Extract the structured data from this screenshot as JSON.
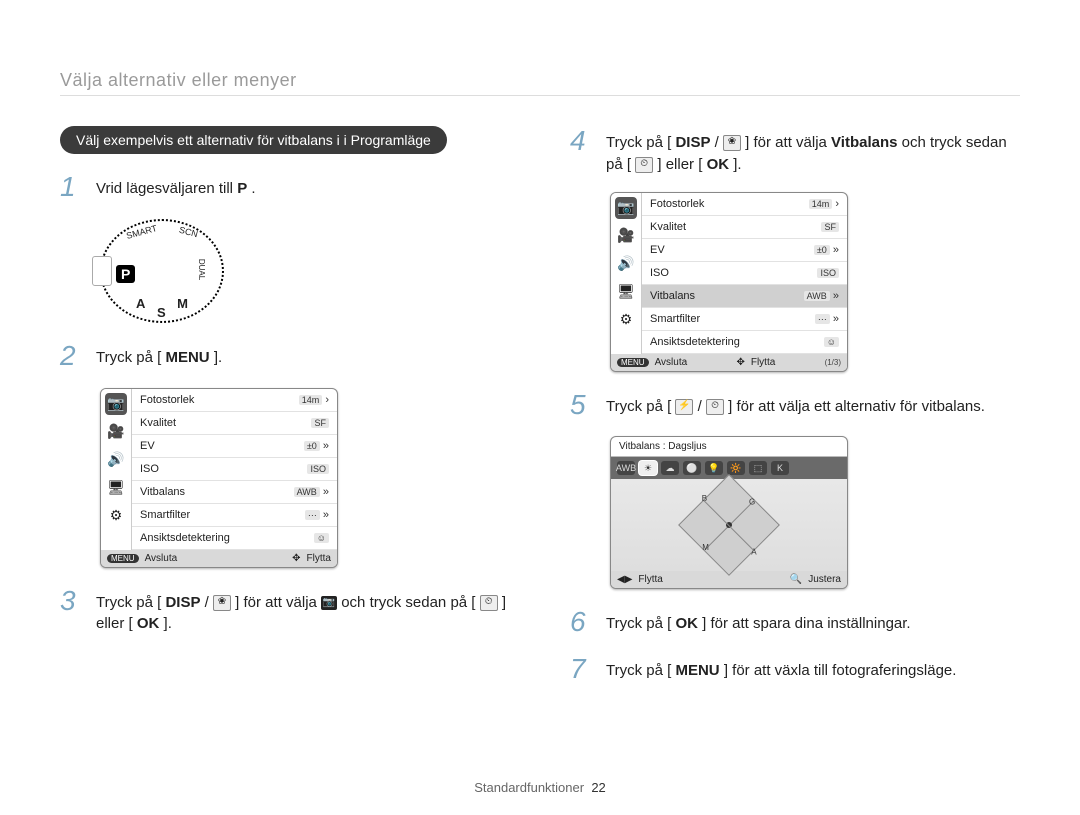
{
  "breadcrumb": "Välja alternativ eller menyer",
  "example_pill": "Välj exempelvis ett alternativ för vitbalans i i Programläge",
  "steps": {
    "1": {
      "num": "1",
      "text_a": "Vrid lägesväljaren till ",
      "mode_letter": "P",
      "text_b": "."
    },
    "2": {
      "num": "2",
      "text_a": "Tryck på [",
      "btn": "MENU",
      "text_b": "]."
    },
    "3": {
      "num": "3",
      "text_a": "Tryck på [",
      "btn_disp": "DISP",
      "text_b": "/",
      "icon_flower": "❀",
      "text_c": "] för att välja ",
      "icon_cam": "📷",
      "text_d": " och tryck sedan på [",
      "icon_timer": "⏲",
      "text_e": "] eller [",
      "btn_ok": "OK",
      "text_f": "]."
    },
    "4": {
      "num": "4",
      "text_a": "Tryck på [",
      "btn_disp": "DISP",
      "text_b": "/",
      "icon_flower": "❀",
      "text_c": "] för att välja ",
      "bold": "Vitbalans",
      "text_d": " och tryck sedan på [",
      "icon_timer": "⏲",
      "text_e": "] eller [",
      "btn_ok": "OK",
      "text_f": "]."
    },
    "5": {
      "num": "5",
      "text_a": "Tryck på [",
      "icon_flash": "⚡",
      "text_b": "/",
      "icon_timer": "⏲",
      "text_c": "] för att välja ett alternativ för vitbalans."
    },
    "6": {
      "num": "6",
      "text_a": "Tryck på [",
      "btn_ok": "OK",
      "text_b": "] för att spara dina inställningar."
    },
    "7": {
      "num": "7",
      "text_a": "Tryck på [",
      "btn_menu": "MENU",
      "text_b": "] för att växla till fotograferingsläge."
    }
  },
  "mode_dial": {
    "scn": "SCN",
    "smart": "SMART",
    "dual": "DUAL",
    "a": "A",
    "s": "S",
    "m": "M",
    "p": "P"
  },
  "lcd_menu": {
    "tabs": [
      "camera",
      "video",
      "sound",
      "display",
      "settings"
    ],
    "active_tab": "camera",
    "rows": [
      {
        "label": "Fotostorlek",
        "val": "14m",
        "arrow": "›"
      },
      {
        "label": "Kvalitet",
        "val": "SF",
        "arrow": ""
      },
      {
        "label": "EV",
        "val": "±0",
        "arrow": "»"
      },
      {
        "label": "ISO",
        "val": "ISO",
        "arrow": ""
      },
      {
        "label": "Vitbalans",
        "val": "AWB",
        "arrow": "»"
      },
      {
        "label": "Smartfilter",
        "val": "⋯",
        "arrow": "»"
      },
      {
        "label": "Ansiktsdetektering",
        "val": "☺",
        "arrow": ""
      }
    ],
    "footer_menu_btn": "MENU",
    "footer_left": "Avsluta",
    "footer_nav_icon": "✥",
    "footer_right": "Flytta",
    "page_indicator": "(1/3)",
    "selected_row_step4": "Vitbalans"
  },
  "wb_lcd": {
    "title": "Vitbalans : Dagsljus",
    "chips": [
      "AWB",
      "☀",
      "☁",
      "⚪",
      "💡",
      "🔆",
      "⬚",
      "K"
    ],
    "selected_chip": "☀",
    "axes": {
      "g": "G",
      "m": "M",
      "b": "B",
      "a": "A"
    },
    "footer_nav_icon": "◀▶",
    "footer_left": "Flytta",
    "footer_zoom_icon": "🔍",
    "footer_right": "Justera"
  },
  "footer": {
    "label": "Standardfunktioner",
    "page": "22"
  }
}
